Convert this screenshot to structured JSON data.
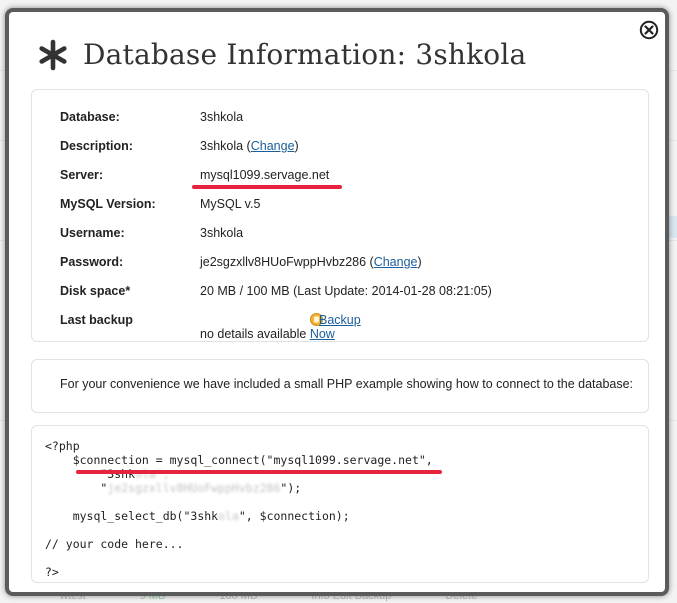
{
  "title": "Database Information: 3shkola",
  "icons": {
    "title": "asterisk-icon",
    "close": "close-circle-icon",
    "backup": "backup-icon"
  },
  "colors": {
    "link": "#1a5e9a",
    "annotation": "#e8233d"
  },
  "info": {
    "database": {
      "label": "Database:",
      "value": "3shkola"
    },
    "description": {
      "label": "Description:",
      "value": "3shkola (",
      "link": "Change",
      "suffix": ")"
    },
    "server": {
      "label": "Server:",
      "value": "mysql1099.servage.net"
    },
    "mysql_version": {
      "label": "MySQL Version:",
      "value": "MySQL v.5"
    },
    "username": {
      "label": "Username:",
      "value": "3shkola"
    },
    "password": {
      "label": "Password:",
      "value": "je2sgzxllv8HUoFwppHvbz286 (",
      "link": "Change",
      "suffix": ")"
    },
    "disk_space": {
      "label": "Disk space*",
      "value": "20 MB / 100 MB (Last Update: 2014-01-28 08:21:05)"
    },
    "last_backup": {
      "label": "Last backup",
      "backup_link": "Backup",
      "value": "no details available",
      "now_link": "Now"
    }
  },
  "convenience": "For your convenience we have included a small PHP example showing how to connect to the database:",
  "code": {
    "line1": "<?php",
    "line2": "    $connection = mysql_connect(\"mysql1099.servage.net\",",
    "line3a": "        \"3shk",
    "line3b": "ola\",",
    "line4a": "        \"",
    "line4b": "je2sgzxllv8HUoFwppHvbz286",
    "line4c": "\");",
    "line5": "",
    "line6a": "    mysql_select_db(\"3shk",
    "line6b": "ola",
    "line6c": "\", $connection);",
    "line7": "",
    "line8": "// your code here...",
    "line9": "",
    "line10": "?>"
  },
  "background": {
    "footer": [
      "wtest",
      "9 MB",
      "100 MB",
      "Info  Edit  Backup",
      "Delete"
    ]
  }
}
